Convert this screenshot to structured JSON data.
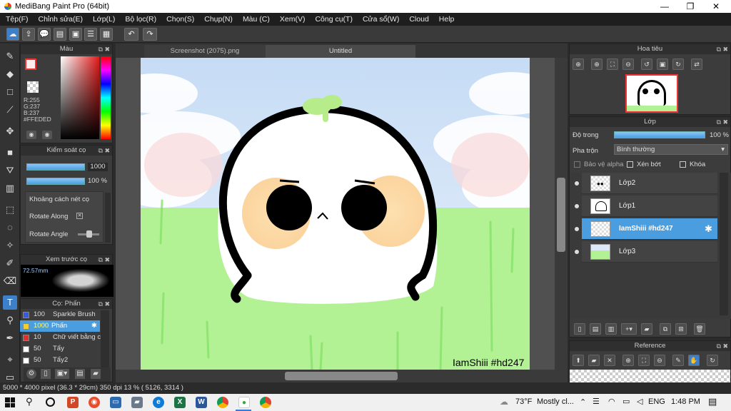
{
  "window": {
    "title": "MediBang Paint Pro (64bit)",
    "minimize": "—",
    "maximize": "❐",
    "close": "✕"
  },
  "menu": [
    "Tệp(F)",
    "Chỉnh sửa(E)",
    "Lớp(L)",
    "Bộ lọc(R)",
    "Chọn(S)",
    "Chụp(N)",
    "Màu (C)",
    "Xem(V)",
    "Công cụ(T)",
    "Cửa sổ(W)",
    "Cloud",
    "Help"
  ],
  "color_panel": {
    "title": "Màu",
    "r": "R:255",
    "g": "G:237",
    "b": "B:237",
    "hex": "#FFEDED"
  },
  "brush_control": {
    "title": "Kiểm soát cọ",
    "size": "1000",
    "opacity": "100 %",
    "spacing_label": "Khoảng cách nét cọ",
    "rotate_along": "Rotate Along",
    "rotate_angle": "Rotate Angle"
  },
  "brush_preview": {
    "title": "Xem trước cọ",
    "size": "72.57mm"
  },
  "brush_list": {
    "title": "Cọ: Phấn",
    "items": [
      {
        "size": "100",
        "name": "Sparkle Brush",
        "color": "#3a5bd9",
        "selected": false
      },
      {
        "size": "1000",
        "name": "Phấn",
        "color": "#f2d024",
        "selected": true
      },
      {
        "size": "10",
        "name": "Chữ viết bằng c",
        "color": "#e03030",
        "selected": false
      },
      {
        "size": "50",
        "name": "Tẩy",
        "color": "#ffffff",
        "selected": false
      },
      {
        "size": "50",
        "name": "Tẩy2",
        "color": "#ffffff",
        "selected": false
      }
    ]
  },
  "tabs": [
    {
      "label": "Screenshot (2075).png",
      "active": false
    },
    {
      "label": "Untitled",
      "active": true
    }
  ],
  "canvas": {
    "signature": "IamShiii #hd247"
  },
  "navigator": {
    "title": "Hoa tiêu"
  },
  "layers_panel": {
    "title": "Lớp",
    "opacity_label": "Độ trong",
    "opacity_value": "100 %",
    "blend_label": "Pha trộn",
    "blend_value": "Bình thường",
    "protect_alpha": "Bảo vệ alpha",
    "clipping": "Xén bớt",
    "lock": "Khóa",
    "layers": [
      {
        "name": "Lớp2",
        "selected": false
      },
      {
        "name": "Lớp1",
        "selected": false
      },
      {
        "name": "IamShiii #hd247",
        "selected": true
      },
      {
        "name": "Lớp3",
        "selected": false
      }
    ]
  },
  "reference": {
    "title": "Reference"
  },
  "status": {
    "text": "5000 * 4000 pixel  (36.3 * 29cm)  350 dpi  13 %  ( 5126, 3314 )"
  },
  "taskbar": {
    "temp": "73°F",
    "weather": "Mostly cl...",
    "lang": "ENG",
    "time": "1:48 PM"
  }
}
